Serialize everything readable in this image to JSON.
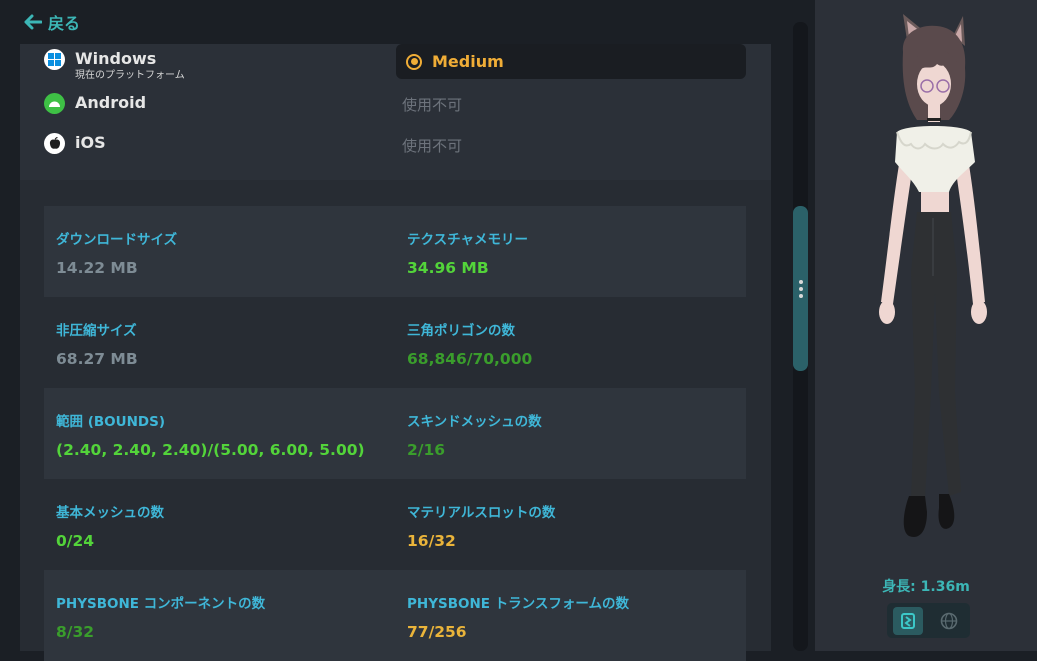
{
  "header": {
    "back_label": "戻る",
    "back_icon": "arrow-left-icon"
  },
  "platforms": [
    {
      "name": "Windows",
      "sub": "現在のプラットフォーム",
      "icon": "windows-icon",
      "icon_color": "#0a8fe0",
      "status": "Medium"
    },
    {
      "name": "Android",
      "sub": "",
      "icon": "android-icon",
      "icon_color": "#3ec045",
      "status": "使用不可"
    },
    {
      "name": "iOS",
      "sub": "",
      "icon": "apple-icon",
      "icon_color": "#1f1f1f",
      "status": "使用不可"
    }
  ],
  "stats": [
    {
      "label": "ダウンロードサイズ",
      "value": "14.22 MB"
    },
    {
      "label": "テクスチャメモリー",
      "value": "34.96 MB"
    },
    {
      "label": "非圧縮サイズ",
      "value": "68.27 MB"
    },
    {
      "label": "三角ポリゴンの数",
      "value": "68,846/70,000"
    },
    {
      "label": "範囲 (BOUNDS)",
      "value": "(2.40, 2.40, 2.40)/(5.00, 6.00, 5.00)"
    },
    {
      "label": "スキンドメッシュの数",
      "value": "2/16"
    },
    {
      "label": "基本メッシュの数",
      "value": "0/24"
    },
    {
      "label": "マテリアルスロットの数",
      "value": "16/32"
    },
    {
      "label": "PHYSBONE コンポーネントの数",
      "value": "8/32"
    },
    {
      "label": "PHYSBONE トランスフォームの数",
      "value": "77/256"
    }
  ],
  "colors": {
    "accent": "#3cb6b6",
    "label": "#3fb7d8",
    "medium": "#f0ad37",
    "good": "#53d43a",
    "ok": "#3a9d2c",
    "warn": "#eab43a",
    "neutral": "#7e8c95"
  },
  "preview": {
    "height_label": "身長: 1.36m",
    "toggle_icons": [
      "avatar-pose-icon",
      "globe-icon"
    ]
  }
}
